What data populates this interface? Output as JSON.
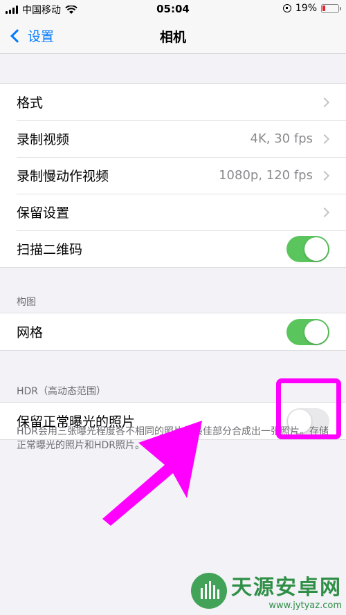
{
  "status_bar": {
    "carrier": "中国移动",
    "time": "05:04",
    "battery": "19%",
    "battery_level": 0.19
  },
  "nav": {
    "back_label": "设置",
    "title": "相机"
  },
  "group1": {
    "rows": [
      {
        "label": "格式",
        "value": ""
      },
      {
        "label": "录制视频",
        "value": "4K, 30 fps"
      },
      {
        "label": "录制慢动作视频",
        "value": "1080p, 120 fps"
      },
      {
        "label": "保留设置",
        "value": ""
      },
      {
        "label": "扫描二维码",
        "toggle": true
      }
    ]
  },
  "composition": {
    "header": "构图",
    "rows": [
      {
        "label": "网格",
        "toggle": true
      }
    ]
  },
  "hdr": {
    "header": "HDR（高动态范围）",
    "rows": [
      {
        "label": "保留正常曝光的照片",
        "toggle": false
      }
    ],
    "footer": "HDR会用三张曝光程度各不相同的照片的最佳部分合成出一张照片。存储正常曝光的照片和HDR照片。"
  },
  "colors": {
    "accent": "#007aff",
    "toggle_on": "#5ac55d",
    "annotation": "#ff00ff"
  },
  "watermark": {
    "title": "天源安卓网",
    "url": "www.jytyaz.com"
  }
}
